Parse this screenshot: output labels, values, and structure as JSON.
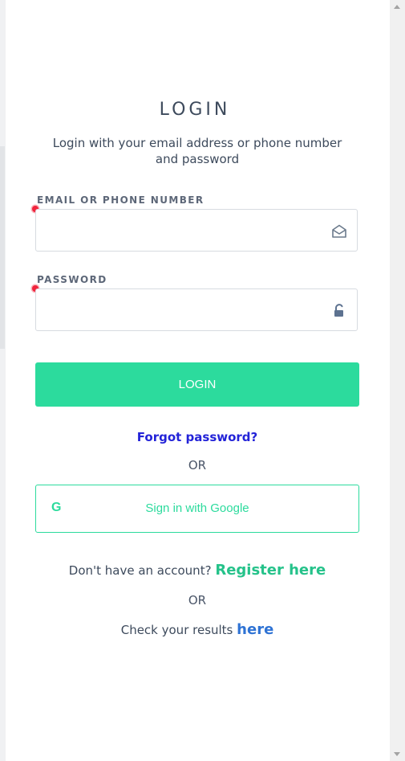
{
  "login": {
    "title": "LOGIN",
    "subtitle": "Login with your email address or phone number and password",
    "email_label": "EMAIL OR PHONE NUMBER",
    "email_value": "",
    "password_label": "PASSWORD",
    "password_value": "",
    "login_button": "LOGIN",
    "forgot_password": "Forgot password?",
    "or_1": "OR",
    "google_letter": "G",
    "google_button": "Sign in with Google",
    "no_account_text": "Don't have an account?",
    "register_link": "Register here",
    "or_2": "OR",
    "results_text": "Check your results",
    "results_link": "here"
  },
  "colors": {
    "accent": "#2cdb9d",
    "required": "#f0243c",
    "forgot_link": "#2323d8",
    "register_link": "#25c28a",
    "here_link": "#2f73d4"
  },
  "icons": {
    "email": "envelope-open-icon",
    "password": "unlock-icon"
  }
}
